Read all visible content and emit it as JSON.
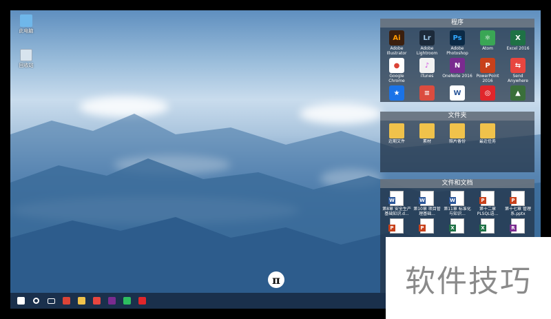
{
  "desktop": {
    "icons": [
      {
        "label": "此电脑",
        "icon": "computer-icon"
      },
      {
        "label": "回收站",
        "icon": "recycle-bin-icon"
      }
    ],
    "pi_symbol": "π"
  },
  "programs": {
    "title": "程序",
    "items": [
      {
        "glyph": "Ai",
        "label": "Adobe Illustrator",
        "color": "#3b1f0e",
        "fg": "#ff9a00"
      },
      {
        "glyph": "Lr",
        "label": "Adobe Lightroom",
        "color": "#1c2a3a",
        "fg": "#9ec6e6"
      },
      {
        "glyph": "Ps",
        "label": "Adobe Photoshop",
        "color": "#0b2a46",
        "fg": "#31a8ff"
      },
      {
        "glyph": "⚛",
        "label": "Atom",
        "color": "#3aa655",
        "fg": "#ffffff"
      },
      {
        "glyph": "X",
        "label": "Excel 2016",
        "color": "#1e7145",
        "fg": "#ffffff"
      },
      {
        "glyph": "●",
        "label": "Google Chrome",
        "color": "#ffffff",
        "fg": "#db4437"
      },
      {
        "glyph": "♪",
        "label": "iTunes",
        "color": "#f2f2f2",
        "fg": "#d24fe0"
      },
      {
        "glyph": "N",
        "label": "OneNote 2016",
        "color": "#7a2b8f",
        "fg": "#ffffff"
      },
      {
        "glyph": "P",
        "label": "PowerPoint 2016",
        "color": "#c8411b",
        "fg": "#ffffff"
      },
      {
        "glyph": "⇆",
        "label": "Send Anywhere",
        "color": "#e8463f",
        "fg": "#ffffff"
      },
      {
        "glyph": "★",
        "label": "",
        "color": "#1a73e8",
        "fg": "#ffffff"
      },
      {
        "glyph": "≡",
        "label": "",
        "color": "#db4c3f",
        "fg": "#ffffff"
      },
      {
        "glyph": "W",
        "label": "",
        "color": "#ffffff",
        "fg": "#2b579a"
      },
      {
        "glyph": "◎",
        "label": "",
        "color": "#e0262b",
        "fg": "#ffffff"
      },
      {
        "glyph": "▲",
        "label": "",
        "color": "#3a6f3a",
        "fg": "#ffffff"
      }
    ]
  },
  "folders": {
    "title": "文件夹",
    "items": [
      {
        "label": "近期文件"
      },
      {
        "label": "素材"
      },
      {
        "label": "照片备份"
      },
      {
        "label": "最近任务"
      }
    ]
  },
  "documents": {
    "title": "文件和文档",
    "items": [
      {
        "label": "第8章 安全生产基础知识.d...",
        "mark": "W",
        "color": "#2b579a"
      },
      {
        "label": "第10章 项目管理基础...",
        "mark": "W",
        "color": "#2b579a"
      },
      {
        "label": "第11章 标准化与知识...",
        "mark": "W",
        "color": "#2b579a"
      },
      {
        "label": "第十二章 PLSQL语...",
        "mark": "P",
        "color": "#c8411b"
      },
      {
        "label": "第十七章 管理系.pptx",
        "mark": "P",
        "color": "#c8411b"
      },
      {
        "label": "",
        "mark": "P",
        "color": "#c8411b"
      },
      {
        "label": "",
        "mark": "P",
        "color": "#c8411b"
      },
      {
        "label": "",
        "mark": "X",
        "color": "#1e7145"
      },
      {
        "label": "",
        "mark": "X",
        "color": "#1e7145"
      },
      {
        "label": "",
        "mark": "R",
        "color": "#7a2b8f"
      }
    ]
  },
  "taskbar": {
    "items": [
      {
        "name": "start-icon",
        "color": "#ffffff"
      },
      {
        "name": "search-icon",
        "color": "#ffffff"
      },
      {
        "name": "task-view-icon",
        "color": "#ffffff"
      },
      {
        "name": "chrome-icon",
        "color": "#db4437"
      },
      {
        "name": "file-explorer-icon",
        "color": "#f0c24b"
      },
      {
        "name": "office-icon",
        "color": "#e8463f"
      },
      {
        "name": "onenote-icon",
        "color": "#7a2b8f"
      },
      {
        "name": "evernote-icon",
        "color": "#2dbe60"
      },
      {
        "name": "netease-music-icon",
        "color": "#e0262b"
      }
    ]
  },
  "watermark": {
    "text": "软件技巧"
  }
}
